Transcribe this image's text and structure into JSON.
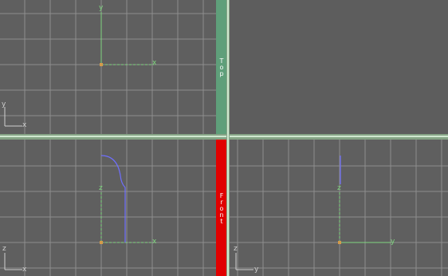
{
  "viewports": {
    "top": {
      "label": "Top",
      "tab_color": "#5f9f7a",
      "state": "inactive"
    },
    "front": {
      "label": "Front",
      "tab_color": "#e00000",
      "state": "active"
    },
    "left": {
      "label": "",
      "tab_color": "",
      "state": "inactive"
    },
    "perspective": {
      "label": "",
      "tab_color": "",
      "state": "empty"
    }
  },
  "axis_labels": {
    "top_center": {
      "x": "x",
      "y": "y"
    },
    "top_corner": {
      "x": "x",
      "y": "y"
    },
    "front_center": {
      "x": "x",
      "z": "z"
    },
    "front_corner": {
      "x": "x",
      "z": "z"
    },
    "left_center": {
      "y": "y",
      "z": "z"
    },
    "left_corner": {
      "y": "y",
      "z": "z"
    }
  },
  "colors": {
    "viewport_bg": "#5f5f5f",
    "grid_line": "#8e8e8e",
    "axis_green": "#7fd67f",
    "shape_blue": "#6f6fff",
    "triad_gray": "#cfcfcf",
    "divider": "#86a486"
  }
}
